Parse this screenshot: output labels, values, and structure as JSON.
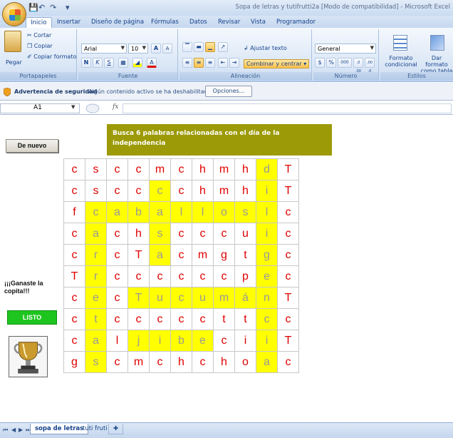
{
  "window": {
    "title": "Sopa de letras y tutifrutti2a [Modo de compatibilidad] - Microsoft Excel"
  },
  "ribbon": {
    "tabs": [
      "Inicio",
      "Insertar",
      "Diseño de página",
      "Fórmulas",
      "Datos",
      "Revisar",
      "Vista",
      "Programador"
    ],
    "clipboard": {
      "paste": "Pegar",
      "cut": "Cortar",
      "copy": "Copiar",
      "format_painter": "Copiar formato",
      "label": "Portapapeles"
    },
    "font": {
      "name": "Arial",
      "size": "10",
      "bold": "N",
      "italic": "K",
      "underline": "S",
      "grow": "A",
      "shrink": "A",
      "color_a": "A",
      "label": "Fuente"
    },
    "alignment": {
      "wrap": "Ajustar texto",
      "merge": "Combinar y centrar",
      "label": "Alineación"
    },
    "number": {
      "format": "General",
      "currency": "$",
      "percent": "%",
      "thousands": "000",
      "inc_decimals": ",0 ,00",
      "dec_decimals": ",00 ,0",
      "label": "Número"
    },
    "styles": {
      "conditional": "Formato condicional",
      "as_table": "Dar formato como tabla",
      "label": "Estilos"
    }
  },
  "security": {
    "title": "Advertencia de seguridad",
    "message": "Algún contenido activo se ha deshabilitado.",
    "options": "Opciones..."
  },
  "formula_bar": {
    "cell": "A1",
    "fx": "fx",
    "value": ""
  },
  "sheet": {
    "restart": "De nuevo",
    "instruction": "Busca 6 palabras relacionadas con el día de la independencia",
    "win_message": "¡¡¡Ganaste la copita!!!",
    "done": "LISTO",
    "grid": [
      [
        "c",
        "s",
        "c",
        "c",
        "m",
        "c",
        "h",
        "m",
        "h",
        "d",
        "T"
      ],
      [
        "c",
        "s",
        "c",
        "c",
        "c",
        "c",
        "h",
        "m",
        "h",
        "i",
        "T"
      ],
      [
        "f",
        "c",
        "a",
        "b",
        "a",
        "l",
        "l",
        "o",
        "s",
        "l",
        "c"
      ],
      [
        "c",
        "a",
        "c",
        "h",
        "s",
        "c",
        "c",
        "c",
        "u",
        "i",
        "c"
      ],
      [
        "c",
        "r",
        "c",
        "T",
        "a",
        "c",
        "m",
        "g",
        "t",
        "g",
        "c"
      ],
      [
        "T",
        "r",
        "c",
        "c",
        "c",
        "c",
        "c",
        "c",
        "p",
        "e",
        "c"
      ],
      [
        "c",
        "e",
        "c",
        "T",
        "u",
        "c",
        "u",
        "m",
        "á",
        "n",
        "T"
      ],
      [
        "c",
        "t",
        "c",
        "c",
        "c",
        "c",
        "c",
        "t",
        "t",
        "c",
        "c"
      ],
      [
        "c",
        "a",
        "l",
        "j",
        "i",
        "b",
        "e",
        "c",
        "i",
        "i",
        "T"
      ],
      [
        "g",
        "s",
        "c",
        "m",
        "c",
        "h",
        "c",
        "h",
        "o",
        "a",
        "c"
      ]
    ],
    "highlights": [
      [
        0,
        9
      ],
      [
        1,
        4
      ],
      [
        1,
        9
      ],
      [
        2,
        1
      ],
      [
        2,
        2
      ],
      [
        2,
        3
      ],
      [
        2,
        4
      ],
      [
        2,
        5
      ],
      [
        2,
        6
      ],
      [
        2,
        7
      ],
      [
        2,
        8
      ],
      [
        2,
        9
      ],
      [
        3,
        1
      ],
      [
        3,
        4
      ],
      [
        3,
        9
      ],
      [
        4,
        1
      ],
      [
        4,
        4
      ],
      [
        4,
        9
      ],
      [
        5,
        1
      ],
      [
        5,
        9
      ],
      [
        6,
        1
      ],
      [
        6,
        3
      ],
      [
        6,
        4
      ],
      [
        6,
        5
      ],
      [
        6,
        6
      ],
      [
        6,
        7
      ],
      [
        6,
        8
      ],
      [
        6,
        9
      ],
      [
        7,
        1
      ],
      [
        7,
        9
      ],
      [
        8,
        1
      ],
      [
        8,
        3
      ],
      [
        8,
        4
      ],
      [
        8,
        5
      ],
      [
        8,
        6
      ],
      [
        8,
        9
      ],
      [
        9,
        1
      ],
      [
        9,
        9
      ]
    ]
  },
  "sheet_tabs": [
    "sopa de letras",
    "tuti fruti"
  ],
  "colors": {
    "letter": "#e00000",
    "found_letter": "#999999",
    "found_fill": "#ffff00",
    "instruction_bg": "#9c9a06",
    "listo_bg": "#1fc51f"
  }
}
